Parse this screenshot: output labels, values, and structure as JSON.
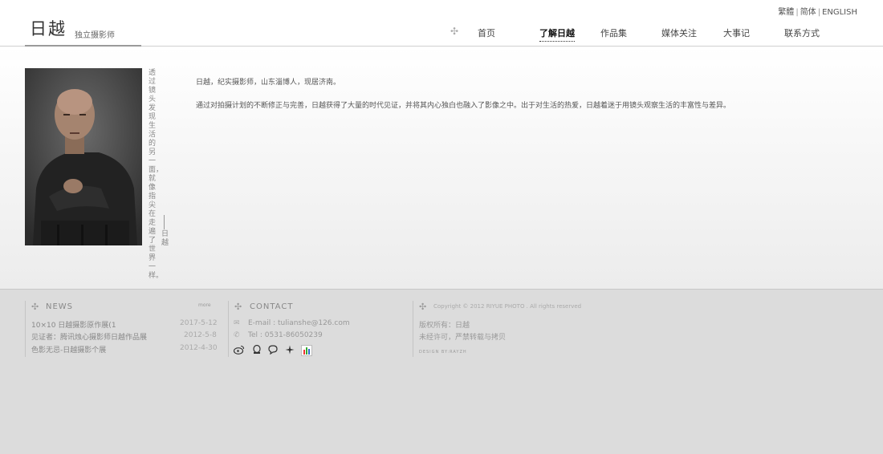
{
  "header": {
    "logo_name": "日越",
    "logo_sub": "独立摄影师",
    "lang": {
      "traditional": "繁體",
      "simplified": "简体",
      "english": "ENGLISH",
      "sep": "|"
    },
    "nav_star": "✣",
    "nav": [
      "首页",
      "了解日越",
      "作品集",
      "媒体关注",
      "大事记",
      "联系方式"
    ],
    "active_nav": "了解日越"
  },
  "main": {
    "photo_alt": "portrait-photo",
    "vertical_quote": "透过镜头发现生活的另一面，就像指尖在走遍了世界一样。",
    "vertical_sign": "日越",
    "intro_line1": "日越，纪实摄影师，山东淄博人，现居济南。",
    "intro_line2": "通过对拍摄计划的不断修正与完善，日越获得了大量的时代见证，并将其内心独白也融入了影像之中。出于对生活的热爱，日越着迷于用镜头观察生活的丰富性与差异。"
  },
  "footer": {
    "news": {
      "title": "NEWS",
      "more": "more",
      "items": [
        {
          "title": "10×10 日越摄影原作展(1",
          "date": "2017-5-12"
        },
        {
          "title": "见证者：腾讯烛心摄影师日越作品展",
          "date": "2012-5-8"
        },
        {
          "title": "色影无忌-日越摄影个展",
          "date": "2012-4-30"
        }
      ]
    },
    "contact": {
      "title": "CONTACT",
      "email": "E-mail : tulianshe@126.com",
      "tel": "Tel : 0531-86050239",
      "email_icon": "✉",
      "tel_icon": "✆",
      "social_icons": [
        "weibo-icon",
        "qq-icon",
        "wechat-icon",
        "star-icon",
        "stats-icon"
      ]
    },
    "copyright": {
      "text": "Copyright © 2012 RIYUE PHOTO . All rights reserved",
      "rights": "版权所有：日越",
      "notice": "未经许可，严禁转载与拷贝",
      "design": "DESIGN BY:RAYZH"
    }
  }
}
